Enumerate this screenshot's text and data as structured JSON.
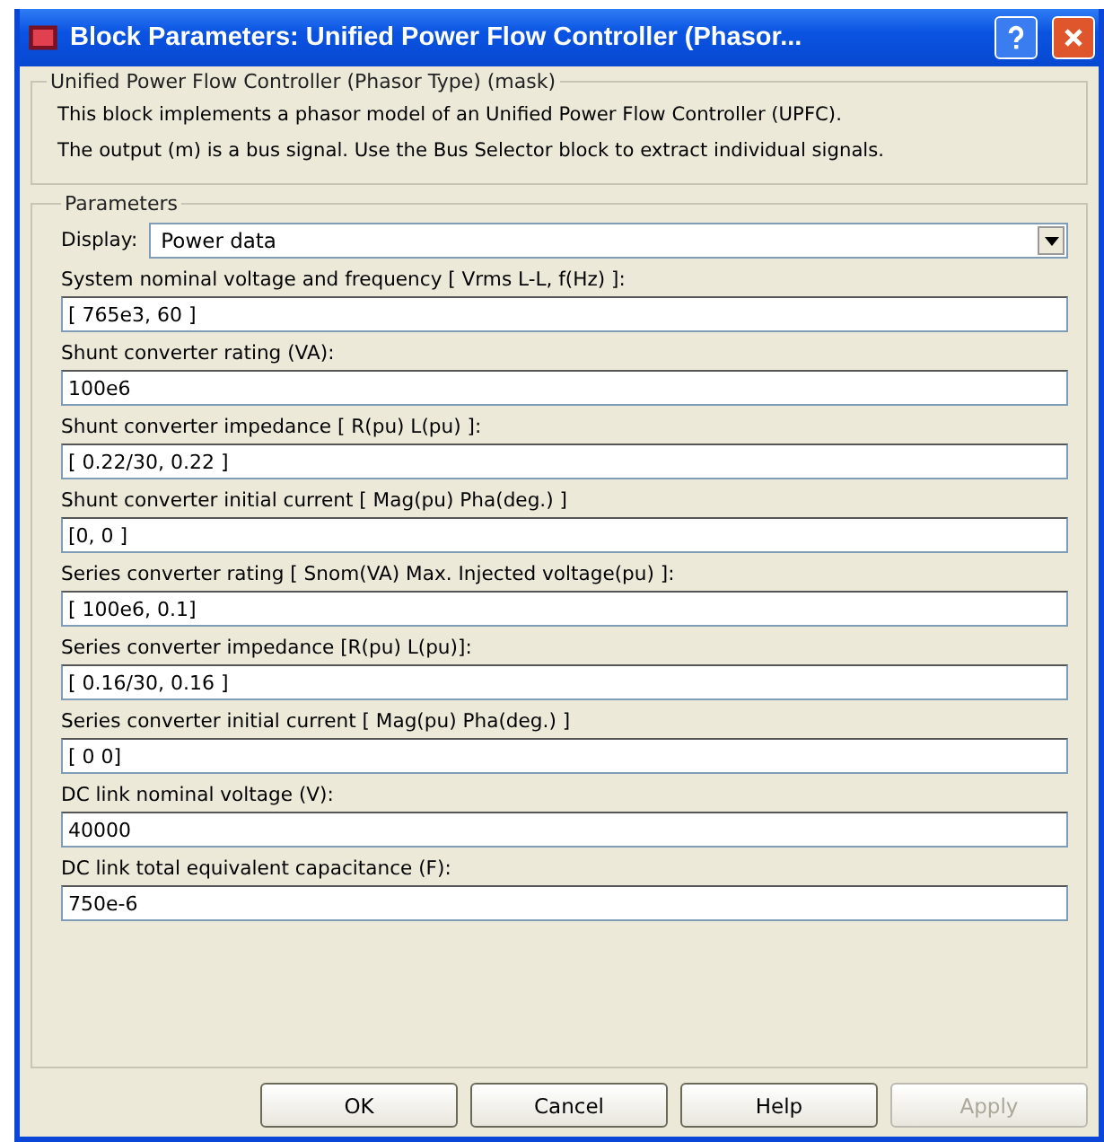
{
  "window": {
    "title": "Block Parameters: Unified Power Flow Controller (Phasor..."
  },
  "description": {
    "title": "Unified Power Flow Controller (Phasor Type) (mask)",
    "lines": [
      "This block implements a phasor model of an Unified Power Flow Controller (UPFC).",
      "The output (m) is a bus signal. Use the Bus Selector block to extract individual signals."
    ]
  },
  "parameters": {
    "title": "Parameters",
    "display": {
      "label": "Display:",
      "value": "Power data"
    },
    "fields": [
      {
        "label": "System nominal voltage and frequency [ Vrms L-L, f(Hz) ]:",
        "value": "[ 765e3, 60 ]"
      },
      {
        "label": "Shunt converter rating (VA):",
        "value": "100e6"
      },
      {
        "label": "Shunt converter impedance [ R(pu)  L(pu) ]:",
        "value": "[ 0.22/30, 0.22 ]"
      },
      {
        "label": "Shunt converter initial current [ Mag(pu)  Pha(deg.) ]",
        "value": "[0, 0 ]"
      },
      {
        "label": "Series converter rating [ Snom(VA)   Max. Injected voltage(pu) ]:",
        "value": "[ 100e6, 0.1]"
      },
      {
        "label": "Series  converter impedance [R(pu)  L(pu)]:",
        "value": "[ 0.16/30, 0.16 ]"
      },
      {
        "label": "Series converter initial current [ Mag(pu)  Pha(deg.) ]",
        "value": "[ 0 0]"
      },
      {
        "label": "DC link nominal voltage (V):",
        "value": "40000"
      },
      {
        "label": "DC link total equivalent capacitance (F):",
        "value": "750e-6"
      }
    ]
  },
  "buttons": [
    {
      "label": "OK",
      "disabled": false
    },
    {
      "label": "Cancel",
      "disabled": false
    },
    {
      "label": "Help",
      "disabled": false
    },
    {
      "label": "Apply",
      "disabled": true
    }
  ]
}
